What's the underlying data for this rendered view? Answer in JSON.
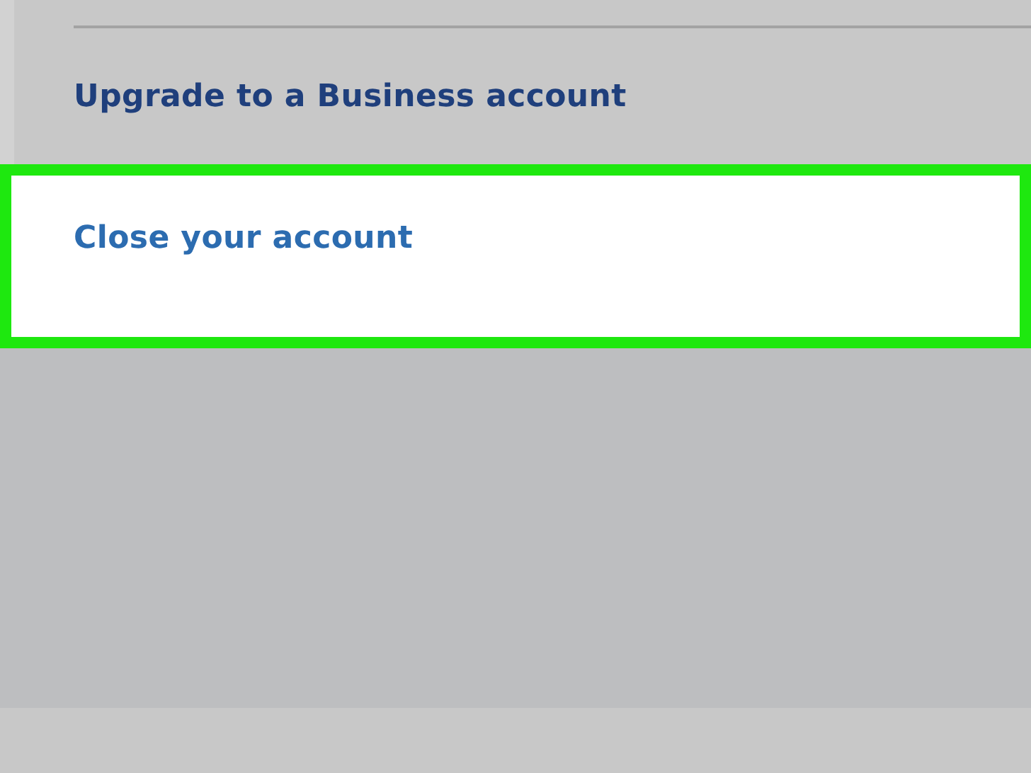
{
  "menu_items": [
    {
      "label": "Upgrade to a Business account",
      "highlighted": false
    },
    {
      "label": "Close your account",
      "highlighted": true
    }
  ]
}
